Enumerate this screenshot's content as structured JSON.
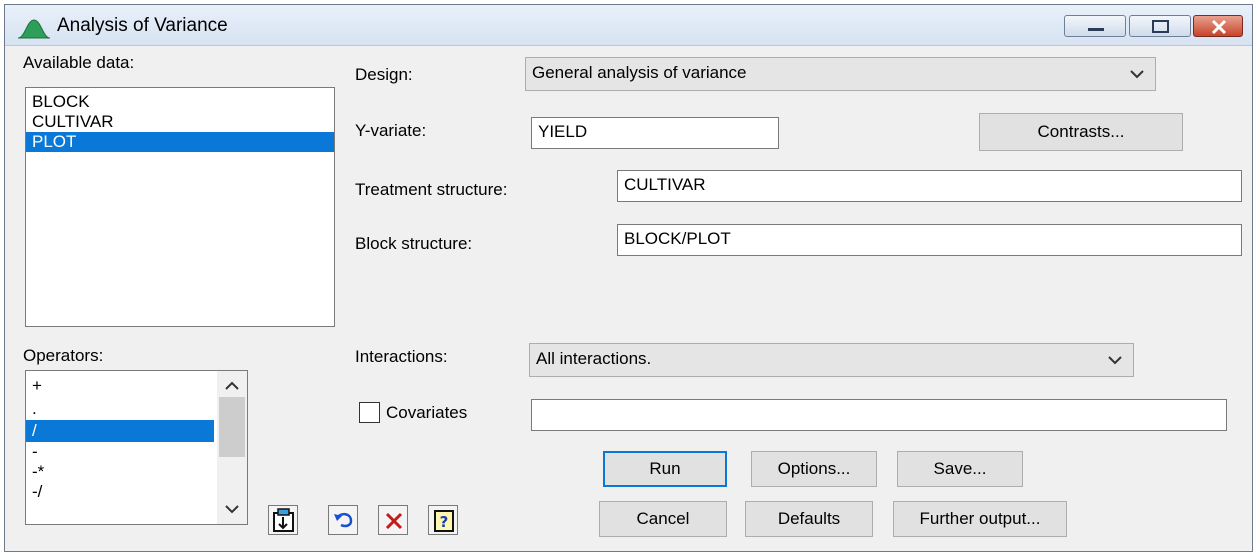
{
  "window": {
    "title": "Analysis of Variance",
    "icon": "normal-curve-icon"
  },
  "available_data": {
    "label": "Available data:",
    "items": [
      "BLOCK",
      "CULTIVAR",
      "PLOT"
    ],
    "selected_index": 2
  },
  "operators": {
    "label": "Operators:",
    "items": [
      "+",
      ".",
      "/",
      "-",
      "-*",
      "-/"
    ],
    "selected_index": 2
  },
  "design": {
    "label": "Design:",
    "value": "General analysis of variance"
  },
  "y_variate": {
    "label": "Y-variate:",
    "value": "YIELD"
  },
  "contrasts_button": "Contrasts...",
  "treatment_structure": {
    "label": "Treatment structure:",
    "value": "CULTIVAR"
  },
  "block_structure": {
    "label": "Block structure:",
    "value": "BLOCK/PLOT"
  },
  "interactions": {
    "label": "Interactions:",
    "value": "All interactions."
  },
  "covariates": {
    "label": "Covariates",
    "checked": false,
    "value": ""
  },
  "buttons": {
    "run": "Run",
    "options": "Options...",
    "save": "Save...",
    "cancel": "Cancel",
    "defaults": "Defaults",
    "further_output": "Further output..."
  },
  "toolbar_icons": [
    "paste-icon",
    "undo-icon",
    "clear-icon",
    "help-icon"
  ],
  "colors": {
    "selection": "#0a78d7",
    "window_bg": "#f0f0f0",
    "close_button": "#c7442b"
  }
}
